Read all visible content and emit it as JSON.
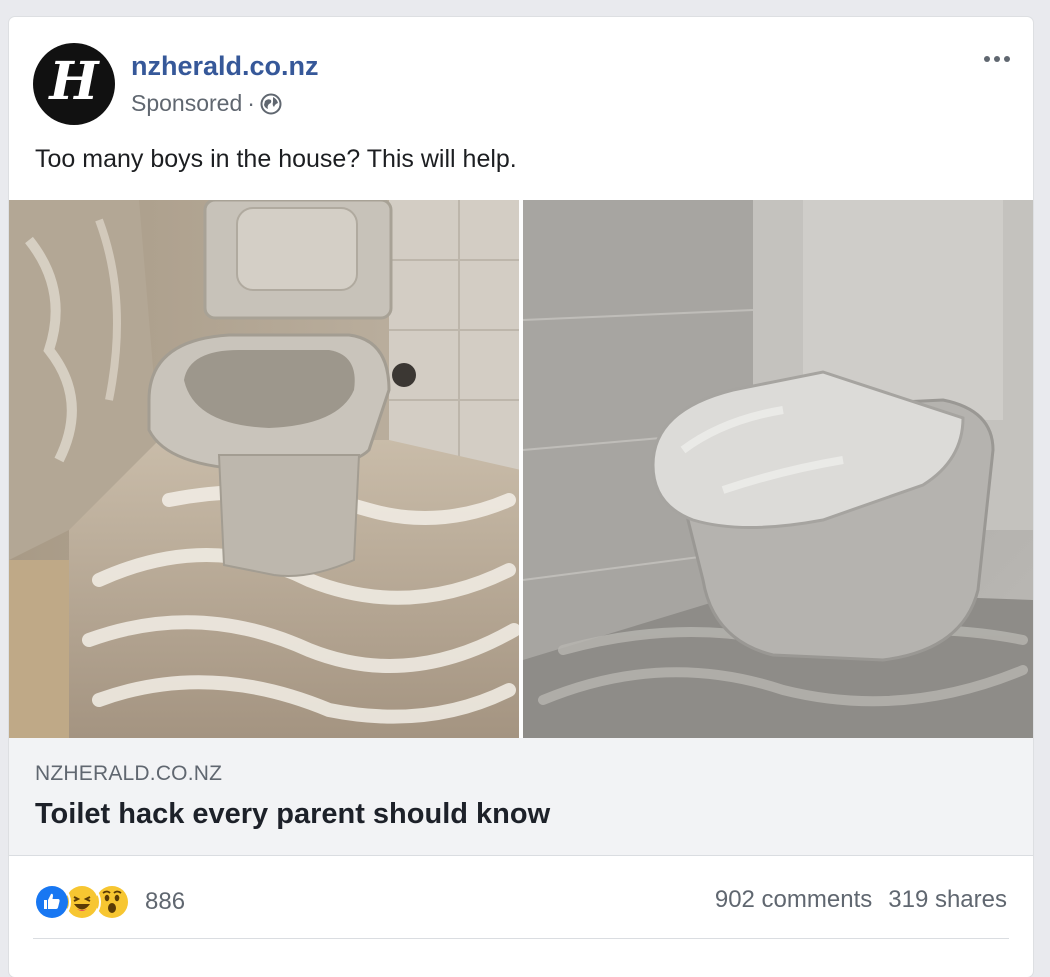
{
  "post": {
    "page_name": "nzherald.co.nz",
    "sponsored_label": "Sponsored",
    "separator": " ·",
    "text": "Too many boys in the house? This will help.",
    "avatar_glyph": "H",
    "icons": {
      "avatar": "nz-herald-logo",
      "privacy": "globe-icon",
      "menu": "more-options-icon"
    }
  },
  "images": {
    "left": {
      "description_icon": "toilet-photo-shaving-cream-floor"
    },
    "right": {
      "description_icon": "toilet-photo-shaving-cream-covered"
    }
  },
  "link_preview": {
    "domain": "NZHERALD.CO.NZ",
    "title": "Toilet hack every parent should know"
  },
  "engagement": {
    "reaction_icons": [
      "like-icon",
      "haha-icon",
      "wow-icon"
    ],
    "reaction_count": "886",
    "comments": "902 comments",
    "shares": "319 shares"
  },
  "colors": {
    "page_name": "#365899",
    "secondary_text": "#606770",
    "link_bg": "#f2f3f5",
    "like_blue": "#1877f2",
    "emoji_yellow": "#f7c631"
  }
}
